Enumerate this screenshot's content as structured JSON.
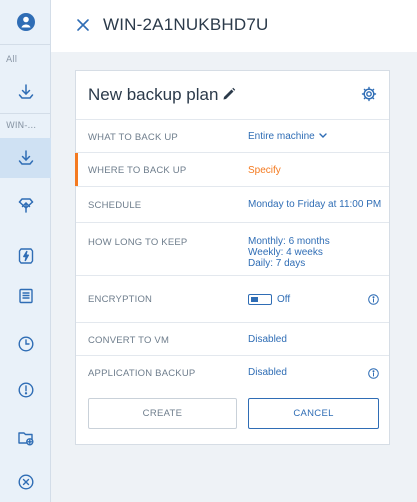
{
  "rail": {
    "label_all": "All",
    "label_device": "WIN-...",
    "items": [
      "account-icon",
      "backup-icon",
      "backup-icon",
      "recovery-icon",
      "protection-icon",
      "report-icon",
      "schedule-icon",
      "alert-icon",
      "folder-add-icon",
      "close-circle-icon"
    ]
  },
  "header": {
    "title": "WIN-2A1NUKBHD7U"
  },
  "plan": {
    "title": "New backup plan",
    "rows": {
      "what": {
        "label": "WHAT TO BACK UP",
        "value": "Entire machine"
      },
      "where": {
        "label": "WHERE TO BACK UP",
        "value": "Specify"
      },
      "schedule": {
        "label": "SCHEDULE",
        "value": "Monday to Friday at 11:00 PM"
      },
      "retention": {
        "label": "HOW LONG TO KEEP",
        "monthly": "Monthly: 6 months",
        "weekly": "Weekly: 4 weeks",
        "daily": "Daily: 7 days"
      },
      "encryption": {
        "label": "ENCRYPTION",
        "value": "Off"
      },
      "convert": {
        "label": "CONVERT TO VM",
        "value": "Disabled"
      },
      "app_backup": {
        "label": "APPLICATION BACKUP",
        "value": "Disabled"
      }
    },
    "buttons": {
      "create": "CREATE",
      "cancel": "CANCEL"
    }
  },
  "colors": {
    "accent": "#2f6db5",
    "warning": "#f47a20",
    "rail_bg": "#e9f1f9",
    "rail_active": "#cfe1f3"
  }
}
